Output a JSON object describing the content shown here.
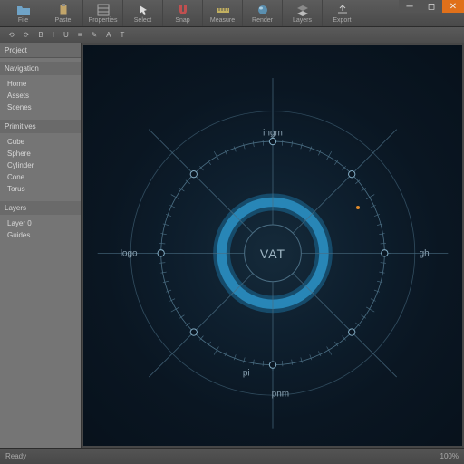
{
  "toolbar": {
    "items": [
      {
        "label": "File",
        "icon": "folder-icon"
      },
      {
        "label": "Paste",
        "icon": "clipboard-icon"
      },
      {
        "label": "Properties",
        "icon": "properties-icon"
      },
      {
        "label": "Select",
        "icon": "cursor-icon"
      },
      {
        "label": "Snap",
        "icon": "magnet-icon"
      },
      {
        "label": "Measure",
        "icon": "ruler-icon"
      },
      {
        "label": "Render",
        "icon": "sphere-icon"
      },
      {
        "label": "Layers",
        "icon": "layers-icon"
      },
      {
        "label": "Export",
        "icon": "export-icon"
      }
    ]
  },
  "subbar": {
    "items": [
      "⟲",
      "⟳",
      "B",
      "I",
      "U",
      "≡",
      "✎",
      "A",
      "T"
    ]
  },
  "panel": {
    "title": "Project",
    "section1_title": "Navigation",
    "section1_items": [
      "Home",
      "Assets",
      "Scenes"
    ],
    "section2_title": "Primitives",
    "section2_items": [
      "Cube",
      "Sphere",
      "Cylinder",
      "Cone",
      "Torus"
    ],
    "section3_title": "Layers",
    "section3_items": [
      "Layer 0",
      "Guides"
    ]
  },
  "canvas": {
    "center_label": "VAT",
    "labels": {
      "top": "ingm",
      "right": "gh",
      "bottom": "pnm",
      "bottom2": "pi",
      "left": "logo"
    },
    "marker_dot": {
      "x_pct": 72,
      "y_pct": 40
    },
    "accent_color": "#2c91c4",
    "ring_color": "#1c6b98",
    "line_color": "#4a6d82"
  },
  "status": {
    "left": "Ready",
    "right": "100%"
  },
  "chart_data": {
    "type": "radar",
    "title": "VAT",
    "axes": [
      "ingm",
      "gh",
      "pnm",
      "pi",
      "logo"
    ],
    "rings": 3,
    "spokes": 8,
    "notes": "No numeric data labels visible; purely diagrammatic dial."
  }
}
